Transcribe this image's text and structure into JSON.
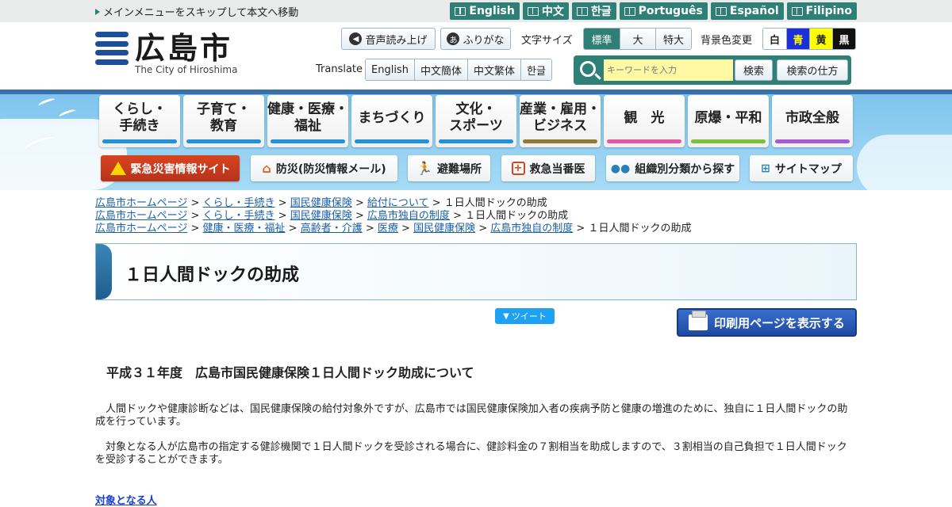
{
  "topbar": {
    "skip_link": "メインメニューをスキップして本文へ移動",
    "languages": [
      "English",
      "中文",
      "한글",
      "Português",
      "Español",
      "Filipino"
    ]
  },
  "logo": {
    "title": "広島市",
    "subtitle": "The City of Hiroshima"
  },
  "tools": {
    "voice": "音声読み上げ",
    "furigana": "ふりがな",
    "furigana_icon": "あ",
    "font_size_label": "文字サイズ",
    "font_sizes": [
      "標準",
      "大",
      "特大"
    ],
    "bg_label": "背景色変更",
    "bg_colors": [
      "白",
      "青",
      "黄",
      "黒"
    ],
    "translate_label": "Translate",
    "translate_langs": [
      "English",
      "中文簡体",
      "中文繁体",
      "한글"
    ],
    "search_placeholder": "キーワードを入力",
    "search_button": "検索",
    "search_how": "検索の仕方"
  },
  "nav": {
    "items": [
      {
        "label": "くらし・\n手続き",
        "color": "#1f93d6"
      },
      {
        "label": "子育て・\n教育",
        "color": "#1f93d6"
      },
      {
        "label": "健康・医療・\n福祉",
        "color": "#1f93d6"
      },
      {
        "label": "まちづくり",
        "color": "#1f93d6"
      },
      {
        "label": "文化・\nスポーツ",
        "color": "#1f93d6"
      },
      {
        "label": "産業・雇用・\nビジネス",
        "color": "#8f7a3a"
      },
      {
        "label": "観　光",
        "color": "#e25aa6"
      },
      {
        "label": "原爆・平和",
        "color": "#7bbf3a"
      },
      {
        "label": "市政全般",
        "color": "#a65ad3"
      }
    ]
  },
  "subnav": {
    "emergency": "緊急災害情報サイト",
    "bousai": "防災(防災情報メール)",
    "hinan": "避難場所",
    "kyukyu": "救急当番医",
    "soshiki": "組織別分類から探す",
    "sitemap": "サイトマップ"
  },
  "breadcrumbs": [
    {
      "links": [
        "広島市ホームページ",
        "くらし・手続き",
        "国民健康保険",
        "給付について"
      ],
      "current": "１日人間ドックの助成"
    },
    {
      "links": [
        "広島市ホームページ",
        "くらし・手続き",
        "国民健康保険",
        "広島市独自の制度"
      ],
      "current": "１日人間ドックの助成"
    },
    {
      "links": [
        "広島市ホームページ",
        "健康・医療・福祉",
        "高齢者・介護",
        "医療",
        "国民健康保険",
        "広島市独自の制度"
      ],
      "current": "１日人間ドックの助成"
    }
  ],
  "page": {
    "title": "１日人間ドックの助成",
    "tweet": "ツイート",
    "print": "印刷用ページを表示する",
    "subheading": "平成３１年度　広島市国民健康保険１日人間ドック助成について",
    "para1": "　人間ドックや健康診断などは、国民健康保険の給付対象外ですが、広島市では国民健康保険加入者の疾病予防と健康の増進のために、独自に１日人間ドックの助成を行っています。",
    "para2": "　対象となる人が広島市の指定する健診機関で１日人間ドックを受診される場合に、健診料金の７割相当を助成しますので、３割相当の自己負担で１日人間ドックを受診することができます。",
    "target_link": "対象となる人"
  }
}
